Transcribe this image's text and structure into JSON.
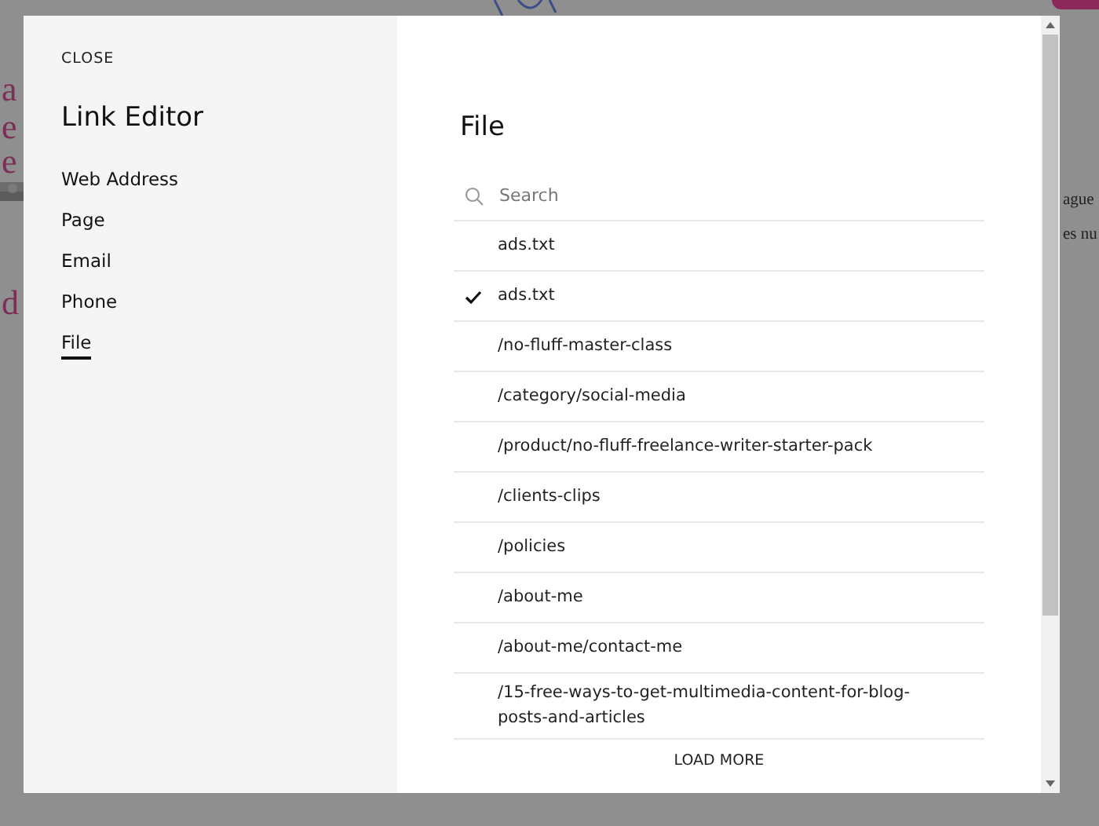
{
  "background": {
    "fragments": [
      {
        "text": "a",
        "kind": "heading"
      },
      {
        "text": "e",
        "kind": "heading"
      },
      {
        "text": "e",
        "kind": "heading"
      },
      {
        "text": "d",
        "kind": "heading"
      },
      {
        "text": "ague",
        "kind": "body"
      },
      {
        "text": "es nu",
        "kind": "body"
      }
    ]
  },
  "sidebar": {
    "close": "CLOSE",
    "title": "Link Editor",
    "items": [
      {
        "label": "Web Address",
        "selected": false
      },
      {
        "label": "Page",
        "selected": false
      },
      {
        "label": "Email",
        "selected": false
      },
      {
        "label": "Phone",
        "selected": false
      },
      {
        "label": "File",
        "selected": true
      }
    ]
  },
  "content": {
    "title": "File",
    "search": {
      "placeholder": "Search"
    },
    "files": [
      {
        "name": "ads.txt",
        "selected": false
      },
      {
        "name": "ads.txt",
        "selected": true
      },
      {
        "name": "/no-fluff-master-class",
        "selected": false
      },
      {
        "name": "/category/social-media",
        "selected": false
      },
      {
        "name": "/product/no-fluff-freelance-writer-starter-pack",
        "selected": false
      },
      {
        "name": "/clients-clips",
        "selected": false
      },
      {
        "name": "/policies",
        "selected": false
      },
      {
        "name": "/about-me",
        "selected": false
      },
      {
        "name": "/about-me/contact-me",
        "selected": false
      },
      {
        "name": "/15-free-ways-to-get-multimedia-content-for-blog-posts-and-articles",
        "selected": false
      }
    ],
    "load_more": "LOAD MORE"
  }
}
